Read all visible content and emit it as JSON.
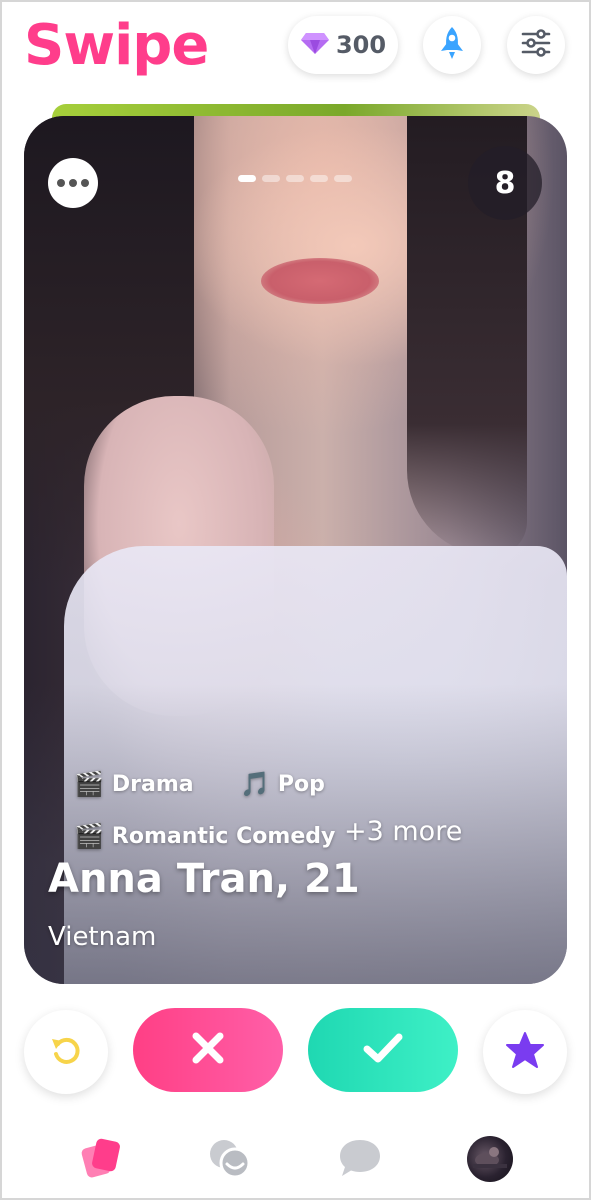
{
  "header": {
    "logo": "Swipe",
    "gems": {
      "value": "300",
      "icon": "diamond-icon"
    },
    "boost_icon": "rocket-icon",
    "filters_icon": "sliders-icon"
  },
  "card": {
    "photo_count": "8",
    "photo_index": 1,
    "photo_total": 5,
    "interests": [
      {
        "label": "Drama",
        "icon": "clapperboard-icon"
      },
      {
        "label": "Pop",
        "icon": "music-note-icon"
      },
      {
        "label": "Romantic Comedy",
        "icon": "clapperboard-icon"
      }
    ],
    "more_interests": "+3 more",
    "name": "Anna Tran, 21",
    "location": "Vietnam"
  },
  "actions": {
    "undo_icon": "undo-icon",
    "nope_icon": "close-icon",
    "like_icon": "check-icon",
    "superlike_icon": "star-icon"
  },
  "nav": [
    "cards-icon",
    "matches-icon",
    "chat-icon",
    "profile-avatar"
  ],
  "colors": {
    "brand": "#ff3d8b",
    "nope": "#ff4f95",
    "like": "#2ce3bc",
    "superlike": "#7a3cf0",
    "undo": "#f7d44a",
    "boost": "#3aa4ff"
  }
}
